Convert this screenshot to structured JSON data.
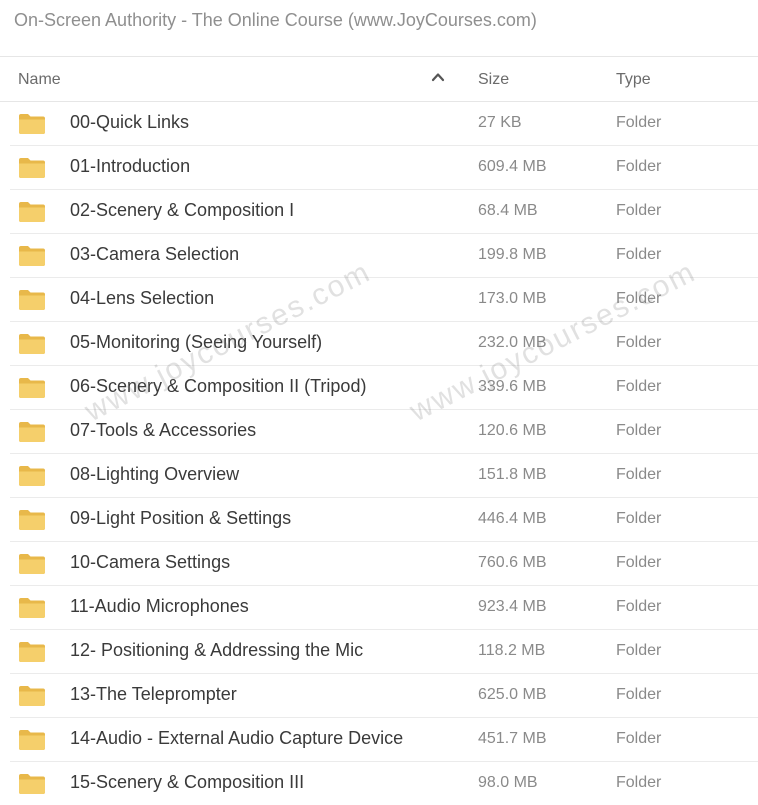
{
  "title": "On-Screen Authority - The Online Course (www.JoyCourses.com)",
  "columns": {
    "name": "Name",
    "size": "Size",
    "type": "Type",
    "sort_icon": "chevron-up-icon"
  },
  "icons": {
    "folder": "folder-icon"
  },
  "colors": {
    "folder": "#f5cf6b",
    "folder_tab": "#e8b84a"
  },
  "rows": [
    {
      "name": "00-Quick Links",
      "size": "27 KB",
      "type": "Folder"
    },
    {
      "name": "01-Introduction",
      "size": "609.4 MB",
      "type": "Folder"
    },
    {
      "name": "02-Scenery & Composition I",
      "size": "68.4 MB",
      "type": "Folder"
    },
    {
      "name": "03-Camera Selection",
      "size": "199.8 MB",
      "type": "Folder"
    },
    {
      "name": "04-Lens Selection",
      "size": "173.0 MB",
      "type": "Folder"
    },
    {
      "name": "05-Monitoring (Seeing Yourself)",
      "size": "232.0 MB",
      "type": "Folder"
    },
    {
      "name": "06-Scenery & Composition II (Tripod)",
      "size": "339.6 MB",
      "type": "Folder"
    },
    {
      "name": "07-Tools & Accessories",
      "size": "120.6 MB",
      "type": "Folder"
    },
    {
      "name": "08-Lighting Overview",
      "size": "151.8 MB",
      "type": "Folder"
    },
    {
      "name": "09-Light Position & Settings",
      "size": "446.4 MB",
      "type": "Folder"
    },
    {
      "name": "10-Camera Settings",
      "size": "760.6 MB",
      "type": "Folder"
    },
    {
      "name": "11-Audio Microphones",
      "size": "923.4 MB",
      "type": "Folder"
    },
    {
      "name": "12- Positioning & Addressing the Mic",
      "size": "118.2 MB",
      "type": "Folder"
    },
    {
      "name": "13-The Teleprompter",
      "size": "625.0 MB",
      "type": "Folder"
    },
    {
      "name": "14-Audio - External Audio Capture Device",
      "size": "451.7 MB",
      "type": "Folder"
    },
    {
      "name": "15-Scenery & Composition III",
      "size": "98.0 MB",
      "type": "Folder"
    }
  ],
  "watermarks": [
    "www.joycourses.com",
    "www.joycourses.com"
  ]
}
